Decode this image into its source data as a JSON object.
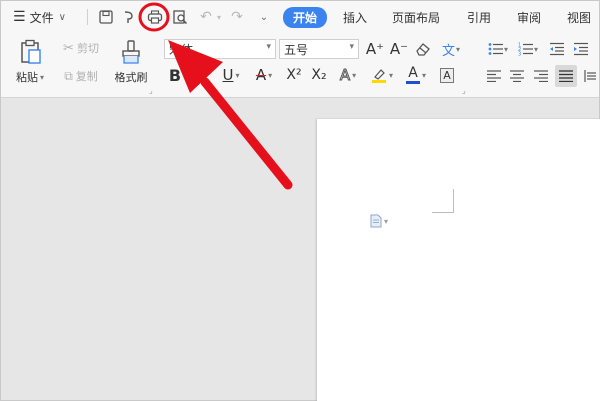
{
  "quickbar": {
    "menu_label": "文件",
    "tabs": [
      {
        "label": "开始",
        "active": true
      },
      {
        "label": "插入",
        "active": false
      },
      {
        "label": "页面布局",
        "active": false
      },
      {
        "label": "引用",
        "active": false
      },
      {
        "label": "审阅",
        "active": false
      },
      {
        "label": "视图",
        "active": false
      }
    ],
    "icons": [
      "menu-icon",
      "save-icon",
      "format-painter-quick-icon",
      "print-icon",
      "print-preview-icon",
      "undo-icon",
      "redo-icon",
      "customize-icon"
    ]
  },
  "ribbon": {
    "clipboard": {
      "paste_label": "粘贴",
      "cut_label": "剪切",
      "copy_label": "复制",
      "format_painter_label": "格式刷"
    },
    "font": {
      "font_name": "宋体",
      "font_size": "五号",
      "grow_label": "A⁺",
      "shrink_label": "A⁻",
      "phonetic_label": "文",
      "bold": "B",
      "italic": "I",
      "underline": "U",
      "strike": "A",
      "superscript": "X²",
      "subscript": "X₂",
      "effect": "A",
      "font_color": "A",
      "char_border": "A"
    }
  },
  "colors": {
    "accent": "#3b84f0",
    "highlight": "#ffd800",
    "font_color": "#1f4fd1",
    "annotation_red": "#e5101b"
  },
  "annotation": {
    "target": "print-button"
  }
}
